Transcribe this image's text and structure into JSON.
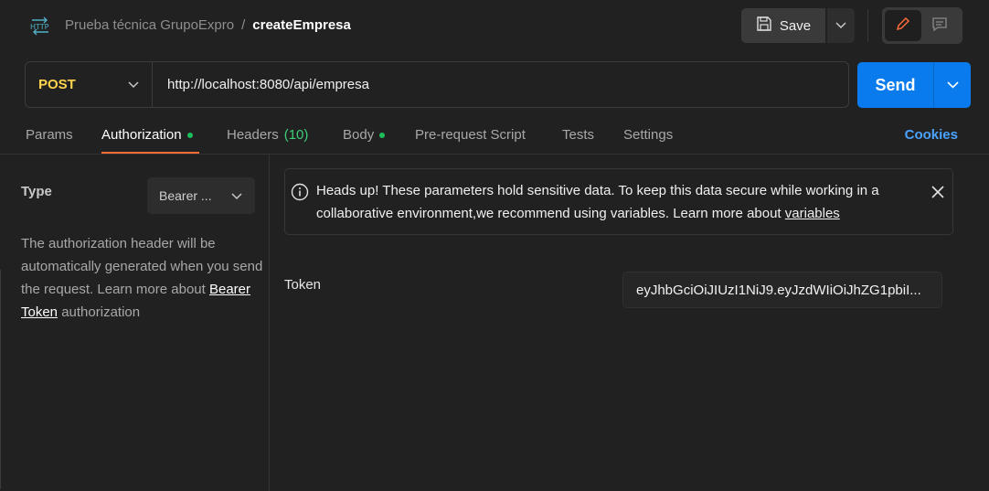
{
  "header": {
    "icon": "http-request-icon",
    "collection": "Prueba técnica GrupoExpro",
    "separator": "/",
    "request_name": "createEmpresa",
    "save_label": "Save"
  },
  "request": {
    "method": "POST",
    "url": "http://localhost:8080/api/empresa",
    "send_label": "Send"
  },
  "tabs": {
    "params": "Params",
    "authorization": "Authorization",
    "headers": "Headers",
    "headers_count": "(10)",
    "body": "Body",
    "prerequest": "Pre-request Script",
    "tests": "Tests",
    "settings": "Settings",
    "cookies": "Cookies",
    "active": "Authorization"
  },
  "auth": {
    "type_label": "Type",
    "type_value": "Bearer ...",
    "help_text_1": "The authorization header will be automatically generated when you send the request. Learn more about ",
    "help_link": "Bearer Token",
    "help_text_2": " authorization"
  },
  "alert": {
    "text": "Heads up! These parameters hold sensitive data. To keep this data secure while working in a collaborative environment,we recommend using variables. Learn more about ",
    "link": "variables"
  },
  "token": {
    "label": "Token",
    "value": "eyJhbGciOiJIUzI1NiJ9.eyJzdWIiOiJhZG1pbiI..."
  },
  "colors": {
    "accent_orange": "#ff6c37",
    "send_blue": "#097bed",
    "method_yellow": "#ffd34d",
    "status_green": "#1cbf5a",
    "link_blue": "#4aa3ff"
  }
}
